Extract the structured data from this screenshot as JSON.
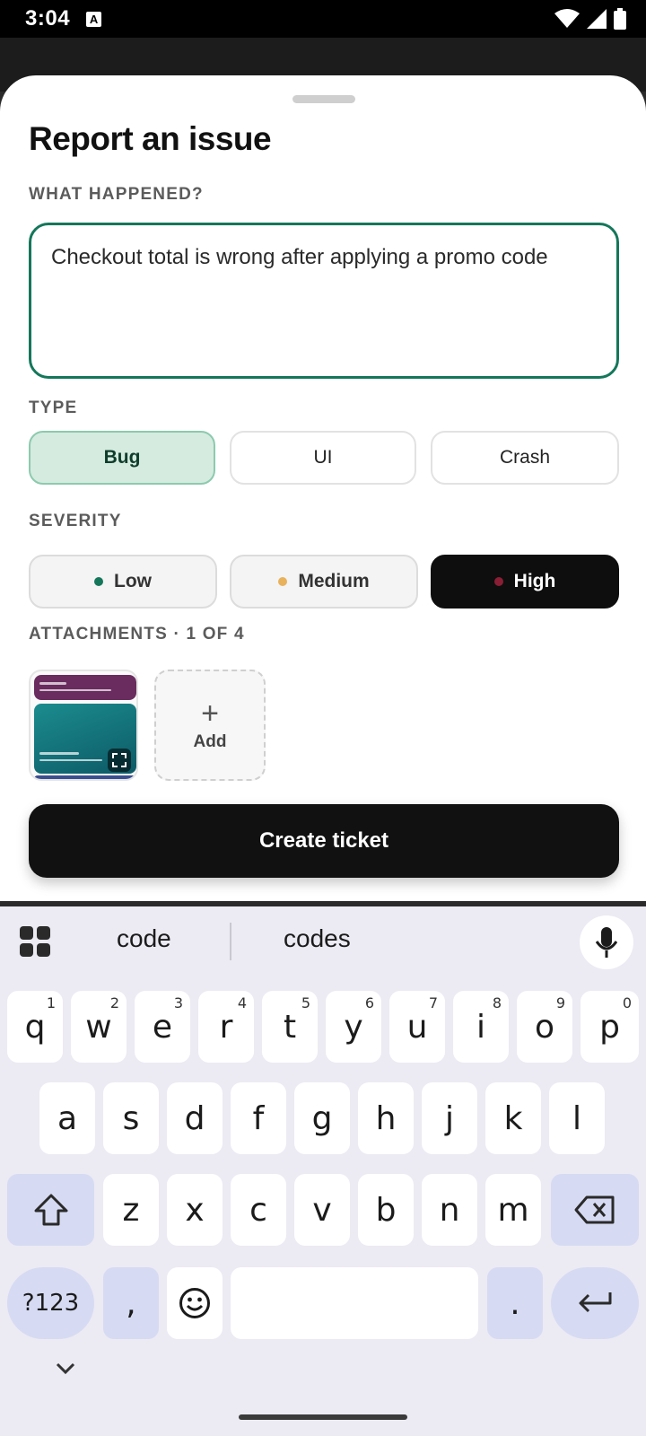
{
  "status_bar": {
    "time": "3:04",
    "notif_letter": "A"
  },
  "sheet": {
    "title": "Report an issue",
    "what_label": "WHAT HAPPENED?",
    "description": "Checkout total is wrong after applying a promo code",
    "type_label": "TYPE",
    "types": [
      {
        "label": "Bug",
        "selected": true
      },
      {
        "label": "UI",
        "selected": false
      },
      {
        "label": "Crash",
        "selected": false
      }
    ],
    "severity_label": "SEVERITY",
    "severities": [
      {
        "label": "Low",
        "dot_color": "#14775a",
        "selected": false
      },
      {
        "label": "Medium",
        "dot_color": "#e8b25c",
        "selected": false
      },
      {
        "label": "High",
        "dot_color": "#8a1e35",
        "selected": true
      }
    ],
    "attachments_label": "ATTACHMENTS · 1 OF 4",
    "add_label": "Add",
    "create_button": "Create ticket"
  },
  "keyboard": {
    "suggestions": [
      "code",
      "codes"
    ],
    "row1": [
      {
        "k": "q",
        "h": "1"
      },
      {
        "k": "w",
        "h": "2"
      },
      {
        "k": "e",
        "h": "3"
      },
      {
        "k": "r",
        "h": "4"
      },
      {
        "k": "t",
        "h": "5"
      },
      {
        "k": "y",
        "h": "6"
      },
      {
        "k": "u",
        "h": "7"
      },
      {
        "k": "i",
        "h": "8"
      },
      {
        "k": "o",
        "h": "9"
      },
      {
        "k": "p",
        "h": "0"
      }
    ],
    "row2": [
      "a",
      "s",
      "d",
      "f",
      "g",
      "h",
      "j",
      "k",
      "l"
    ],
    "row3": [
      "z",
      "x",
      "c",
      "v",
      "b",
      "n",
      "m"
    ],
    "symbols_key": "?123",
    "comma_key": ",",
    "period_key": "."
  },
  "colors": {
    "accent": "#14775a",
    "selected_chip_bg": "#d5ebe0",
    "keyboard_bg": "#eceaf3",
    "mod_key_bg": "#d6dbf3"
  }
}
